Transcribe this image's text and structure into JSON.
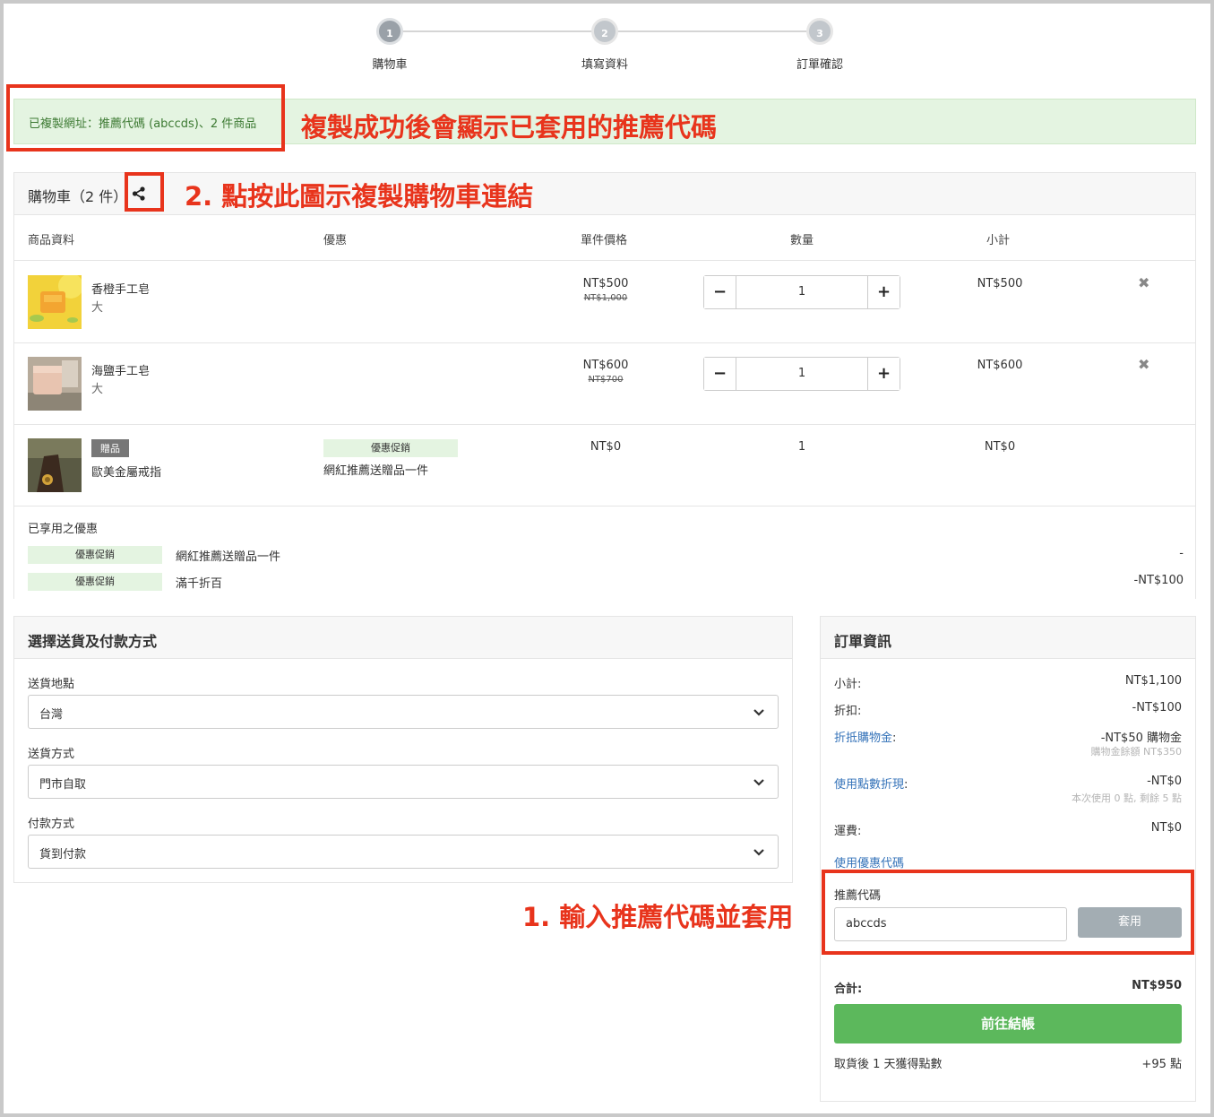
{
  "steps": [
    {
      "num": "1",
      "label": "購物車"
    },
    {
      "num": "2",
      "label": "填寫資料"
    },
    {
      "num": "3",
      "label": "訂單確認"
    }
  ],
  "success_message": "已複製網址：推薦代碼 (abccds)、2 件商品",
  "annotations": {
    "copy_success": "複製成功後會顯示已套用的推薦代碼",
    "share_hint": "2. 點按此圖示複製購物車連結",
    "input_hint": "1. 輸入推薦代碼並套用"
  },
  "cart": {
    "title": "購物車（2 件）",
    "columns": [
      "商品資料",
      "優惠",
      "單件價格",
      "數量",
      "小計"
    ],
    "items": [
      {
        "name": "香橙手工皂",
        "variant": "大",
        "price": "NT$500",
        "old_price": "NT$1,000",
        "qty": "1",
        "subtotal": "NT$500",
        "remove": "✖"
      },
      {
        "name": "海鹽手工皂",
        "variant": "大",
        "price": "NT$600",
        "old_price": "NT$700",
        "qty": "1",
        "subtotal": "NT$600",
        "remove": "✖"
      },
      {
        "name": "歐美金屬戒指",
        "tag": "贈品",
        "promo_tag": "優惠促銷",
        "promo_name": "網紅推薦送贈品一件",
        "price": "NT$0",
        "qty": "1",
        "subtotal": "NT$0"
      }
    ],
    "qty_minus": "−",
    "qty_plus": "+",
    "applied_title": "已享用之優惠",
    "applied": [
      {
        "tag": "優惠促銷",
        "name": "網紅推薦送贈品一件",
        "value": "-"
      },
      {
        "tag": "優惠促銷",
        "name": "滿千折百",
        "value": "-NT$100"
      }
    ]
  },
  "shipping": {
    "title": "選擇送貨及付款方式",
    "fields": [
      {
        "label": "送貨地點",
        "value": "台灣"
      },
      {
        "label": "送貨方式",
        "value": "門市自取"
      },
      {
        "label": "付款方式",
        "value": "貨到付款"
      }
    ]
  },
  "order": {
    "title": "訂單資訊",
    "subtotal_label": "小計:",
    "subtotal_value": "NT$1,100",
    "discount_label": "折扣:",
    "discount_value": "-NT$100",
    "credit_label": "折抵購物金",
    "credit_colon": ":",
    "credit_value": "-NT$50 購物金",
    "credit_sub": "購物金餘額 NT$350",
    "points_label": "使用點數折現",
    "points_colon": ":",
    "points_value": "-NT$0",
    "points_sub": "本次使用 0 點, 剩餘 5 點",
    "shipping_label": "運費:",
    "shipping_value": "NT$0",
    "coupon_link": "使用優惠代碼",
    "referral_label": "推薦代碼",
    "referral_value": "abccds",
    "apply_label": "套用",
    "total_label": "合計:",
    "total_value": "NT$950",
    "checkout_label": "前往結帳",
    "points_earn_label": "取貨後 1 天獲得點數",
    "points_earn_value": "+95 點"
  },
  "colors": {
    "accent_green": "#5cb85c",
    "annotation_red": "#e8341c",
    "link_blue": "#3573b9"
  }
}
